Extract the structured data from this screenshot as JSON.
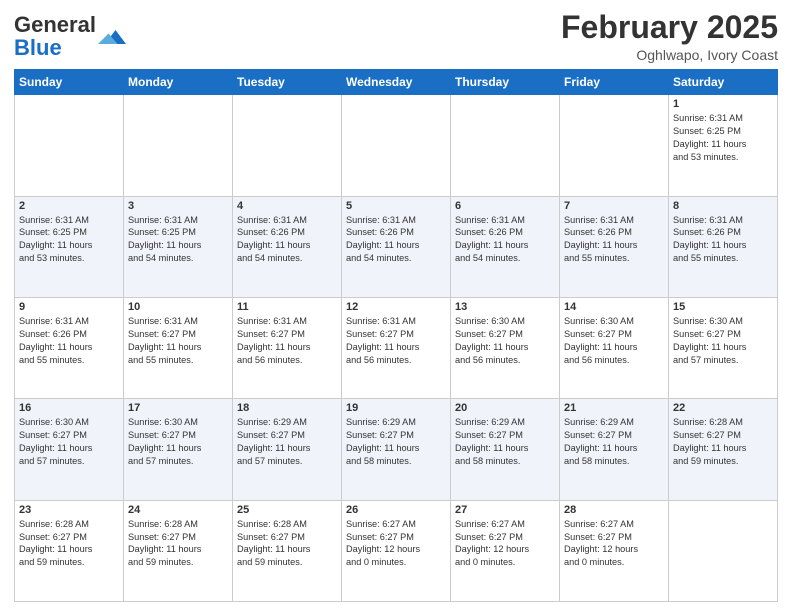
{
  "header": {
    "logo_general": "General",
    "logo_blue": "Blue",
    "month": "February 2025",
    "location": "Oghlwapo, Ivory Coast"
  },
  "weekdays": [
    "Sunday",
    "Monday",
    "Tuesday",
    "Wednesday",
    "Thursday",
    "Friday",
    "Saturday"
  ],
  "weeks": [
    [
      {
        "day": "",
        "info": ""
      },
      {
        "day": "",
        "info": ""
      },
      {
        "day": "",
        "info": ""
      },
      {
        "day": "",
        "info": ""
      },
      {
        "day": "",
        "info": ""
      },
      {
        "day": "",
        "info": ""
      },
      {
        "day": "1",
        "info": "Sunrise: 6:31 AM\nSunset: 6:25 PM\nDaylight: 11 hours\nand 53 minutes."
      }
    ],
    [
      {
        "day": "2",
        "info": "Sunrise: 6:31 AM\nSunset: 6:25 PM\nDaylight: 11 hours\nand 53 minutes."
      },
      {
        "day": "3",
        "info": "Sunrise: 6:31 AM\nSunset: 6:25 PM\nDaylight: 11 hours\nand 54 minutes."
      },
      {
        "day": "4",
        "info": "Sunrise: 6:31 AM\nSunset: 6:26 PM\nDaylight: 11 hours\nand 54 minutes."
      },
      {
        "day": "5",
        "info": "Sunrise: 6:31 AM\nSunset: 6:26 PM\nDaylight: 11 hours\nand 54 minutes."
      },
      {
        "day": "6",
        "info": "Sunrise: 6:31 AM\nSunset: 6:26 PM\nDaylight: 11 hours\nand 54 minutes."
      },
      {
        "day": "7",
        "info": "Sunrise: 6:31 AM\nSunset: 6:26 PM\nDaylight: 11 hours\nand 55 minutes."
      },
      {
        "day": "8",
        "info": "Sunrise: 6:31 AM\nSunset: 6:26 PM\nDaylight: 11 hours\nand 55 minutes."
      }
    ],
    [
      {
        "day": "9",
        "info": "Sunrise: 6:31 AM\nSunset: 6:26 PM\nDaylight: 11 hours\nand 55 minutes."
      },
      {
        "day": "10",
        "info": "Sunrise: 6:31 AM\nSunset: 6:27 PM\nDaylight: 11 hours\nand 55 minutes."
      },
      {
        "day": "11",
        "info": "Sunrise: 6:31 AM\nSunset: 6:27 PM\nDaylight: 11 hours\nand 56 minutes."
      },
      {
        "day": "12",
        "info": "Sunrise: 6:31 AM\nSunset: 6:27 PM\nDaylight: 11 hours\nand 56 minutes."
      },
      {
        "day": "13",
        "info": "Sunrise: 6:30 AM\nSunset: 6:27 PM\nDaylight: 11 hours\nand 56 minutes."
      },
      {
        "day": "14",
        "info": "Sunrise: 6:30 AM\nSunset: 6:27 PM\nDaylight: 11 hours\nand 56 minutes."
      },
      {
        "day": "15",
        "info": "Sunrise: 6:30 AM\nSunset: 6:27 PM\nDaylight: 11 hours\nand 57 minutes."
      }
    ],
    [
      {
        "day": "16",
        "info": "Sunrise: 6:30 AM\nSunset: 6:27 PM\nDaylight: 11 hours\nand 57 minutes."
      },
      {
        "day": "17",
        "info": "Sunrise: 6:30 AM\nSunset: 6:27 PM\nDaylight: 11 hours\nand 57 minutes."
      },
      {
        "day": "18",
        "info": "Sunrise: 6:29 AM\nSunset: 6:27 PM\nDaylight: 11 hours\nand 57 minutes."
      },
      {
        "day": "19",
        "info": "Sunrise: 6:29 AM\nSunset: 6:27 PM\nDaylight: 11 hours\nand 58 minutes."
      },
      {
        "day": "20",
        "info": "Sunrise: 6:29 AM\nSunset: 6:27 PM\nDaylight: 11 hours\nand 58 minutes."
      },
      {
        "day": "21",
        "info": "Sunrise: 6:29 AM\nSunset: 6:27 PM\nDaylight: 11 hours\nand 58 minutes."
      },
      {
        "day": "22",
        "info": "Sunrise: 6:28 AM\nSunset: 6:27 PM\nDaylight: 11 hours\nand 59 minutes."
      }
    ],
    [
      {
        "day": "23",
        "info": "Sunrise: 6:28 AM\nSunset: 6:27 PM\nDaylight: 11 hours\nand 59 minutes."
      },
      {
        "day": "24",
        "info": "Sunrise: 6:28 AM\nSunset: 6:27 PM\nDaylight: 11 hours\nand 59 minutes."
      },
      {
        "day": "25",
        "info": "Sunrise: 6:28 AM\nSunset: 6:27 PM\nDaylight: 11 hours\nand 59 minutes."
      },
      {
        "day": "26",
        "info": "Sunrise: 6:27 AM\nSunset: 6:27 PM\nDaylight: 12 hours\nand 0 minutes."
      },
      {
        "day": "27",
        "info": "Sunrise: 6:27 AM\nSunset: 6:27 PM\nDaylight: 12 hours\nand 0 minutes."
      },
      {
        "day": "28",
        "info": "Sunrise: 6:27 AM\nSunset: 6:27 PM\nDaylight: 12 hours\nand 0 minutes."
      },
      {
        "day": "",
        "info": ""
      }
    ]
  ]
}
